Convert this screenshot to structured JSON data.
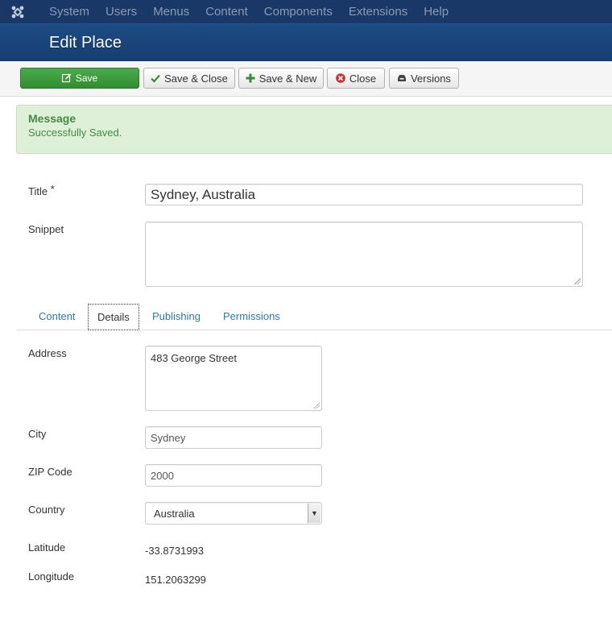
{
  "menu": {
    "logo_icon": "joomla-logo-icon",
    "items": [
      "System",
      "Users",
      "Menus",
      "Content",
      "Components",
      "Extensions",
      "Help"
    ]
  },
  "header": {
    "title": "Edit Place"
  },
  "toolbar": {
    "save": "Save",
    "save_close": "Save & Close",
    "save_new": "Save & New",
    "close": "Close",
    "versions": "Versions"
  },
  "message": {
    "heading": "Message",
    "text": "Successfully Saved."
  },
  "form": {
    "title_label": "Title",
    "required_mark": "*",
    "title_value": "Sydney, Australia",
    "snippet_label": "Snippet",
    "snippet_value": ""
  },
  "tabs": [
    "Content",
    "Details",
    "Publishing",
    "Permissions"
  ],
  "active_tab": "Details",
  "details": {
    "address_label": "Address",
    "address_value": "483 George Street",
    "city_label": "City",
    "city_value": "Sydney",
    "zip_label": "ZIP Code",
    "zip_value": "2000",
    "country_label": "Country",
    "country_value": "Australia",
    "latitude_label": "Latitude",
    "latitude_value": "-33.8731993",
    "longitude_label": "Longitude",
    "longitude_value": "151.2063299"
  },
  "colors": {
    "menubar": "#1a3867",
    "subhead": "#1d4b84",
    "save_green": "#3e9c3e",
    "message_bg": "#dff0d8",
    "message_text": "#468847",
    "tab_link": "#2a7ab0"
  }
}
